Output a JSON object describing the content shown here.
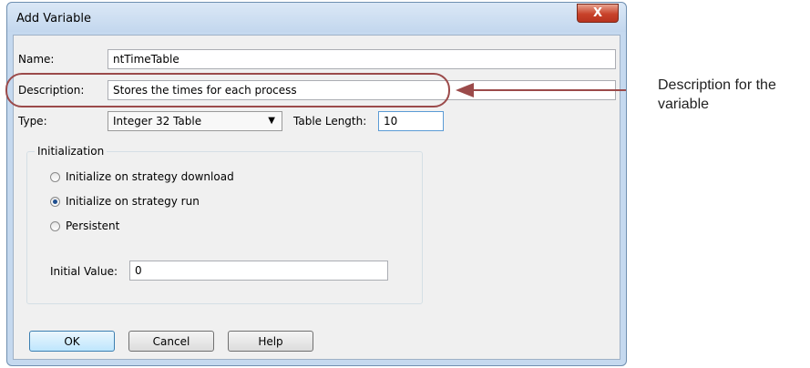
{
  "window": {
    "title": "Add Variable",
    "close_label": "X"
  },
  "form": {
    "name_label": "Name:",
    "name_value": "ntTimeTable",
    "description_label": "Description:",
    "description_value": "Stores the times for each process",
    "type_label": "Type:",
    "type_value": "Integer 32 Table",
    "table_length_label": "Table Length:",
    "table_length_value": "10"
  },
  "initialization": {
    "title": "Initialization",
    "options": [
      {
        "label": "Initialize on strategy download",
        "checked": false
      },
      {
        "label": "Initialize on strategy run",
        "checked": true
      },
      {
        "label": "Persistent",
        "checked": false
      }
    ],
    "initial_value_label": "Initial Value:",
    "initial_value": "0"
  },
  "buttons": {
    "ok": "OK",
    "cancel": "Cancel",
    "help": "Help"
  },
  "callout": {
    "text": "Description for the variable",
    "color": "#9b4a4a"
  }
}
